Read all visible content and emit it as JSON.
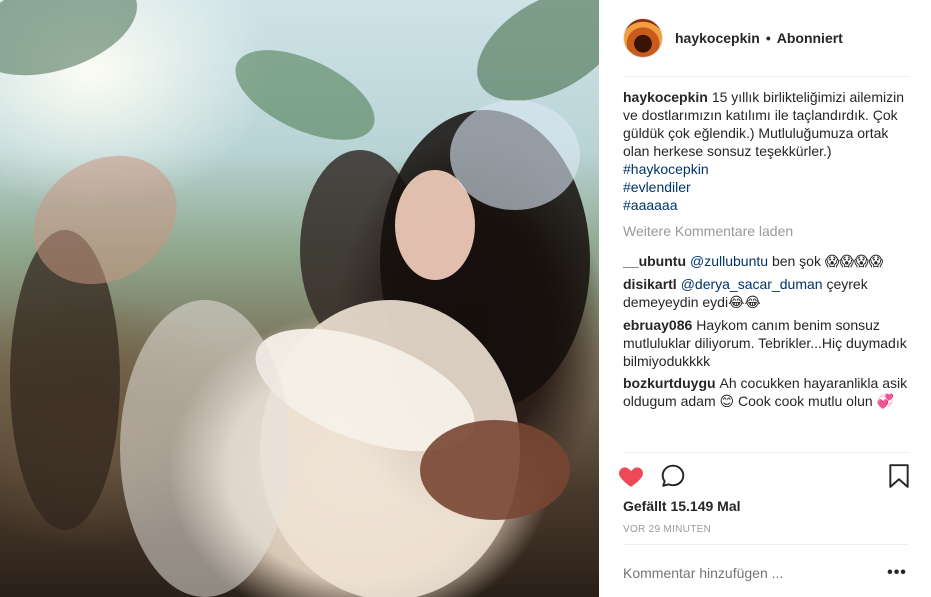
{
  "post": {
    "username": "haykocepkin",
    "separator": "•",
    "follow_status": "Abonniert",
    "caption": {
      "user": "haykocepkin",
      "text": "15 yıllık birlikteliğimizi ailemizin ve dostlarımızın katılımı ile taçlandırdık. Çok güldük çok eğlendik.) Mutluluğumuza ortak olan herkese sonsuz teşekkürler.)",
      "hashtags": [
        "#haykocepkin",
        "#evlendiler",
        "#aaaaaa"
      ]
    },
    "load_more": "Weitere Kommentare laden",
    "comments": [
      {
        "user": "__ubuntu",
        "mention": "@zullubuntu",
        "text": "ben şok",
        "emoji": "😱😱😱😱"
      },
      {
        "user": "disikartl",
        "mention": "@derya_sacar_duman",
        "text": "çeyrek demeyeydin eydi",
        "emoji": "😂😂"
      },
      {
        "user": "ebruay086",
        "mention": "",
        "text": "Haykom canım benim sonsuz mutluluklar diliyorum. Tebrikler...Hiç duymadık bilmiyodukkkk",
        "emoji": ""
      },
      {
        "user": "bozkurtduygu",
        "mention": "",
        "text": "Ah cocukken hayaranlikla asik oldugum adam",
        "emoji": "😊",
        "text2": "Cook cook mutlu olun",
        "emoji2": "💞"
      }
    ],
    "likes": "Gefällt 15.149 Mal",
    "timestamp": "VOR 29 MINUTEN",
    "comment_placeholder": "Kommentar hinzufügen ...",
    "more_label": "•••",
    "colors": {
      "heart": "#ed4956",
      "link": "#003569",
      "muted": "#999999",
      "text": "#262626"
    },
    "icons": [
      "heart-icon",
      "comment-icon",
      "bookmark-icon",
      "more-options-icon"
    ]
  }
}
